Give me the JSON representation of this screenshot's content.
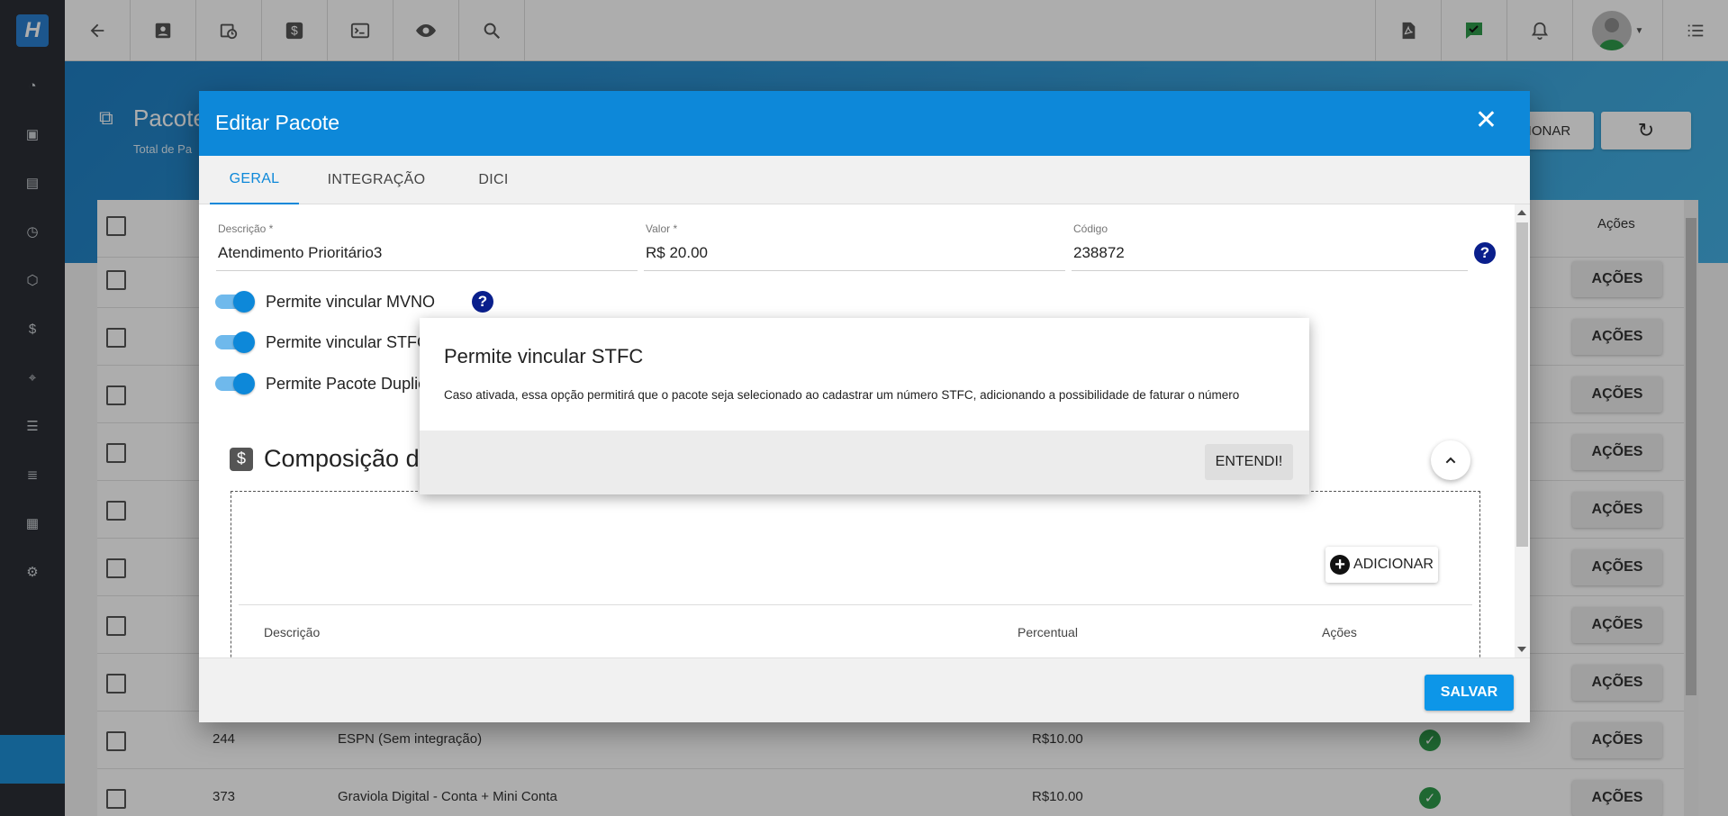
{
  "background": {
    "page_title": "Pacote",
    "page_subtitle": "Total de Pa",
    "header_button_partial": "CIONAR",
    "table_header_acoes": "Ações",
    "row_action_label": "AÇÕES",
    "rows": [
      {
        "id": "244",
        "descricao": "ESPN (Sem integração)",
        "valor": "R$10.00"
      },
      {
        "id": "373",
        "descricao": "Graviola Digital - Conta + Mini Conta",
        "valor": "R$10.00"
      }
    ]
  },
  "topbar_icons": [
    "back-arrow-icon",
    "contact-card-icon",
    "calendar-clock-icon",
    "dollar-icon",
    "terminal-icon",
    "eye-icon",
    "search-icon"
  ],
  "modal": {
    "title": "Editar Pacote",
    "close_symbol": "✕",
    "tabs": [
      {
        "label": "GERAL",
        "active": true
      },
      {
        "label": "INTEGRAÇÃO",
        "active": false
      },
      {
        "label": "DICI",
        "active": false
      }
    ],
    "fields": {
      "descricao": {
        "label": "Descrição *",
        "value": "Atendimento Prioritário3"
      },
      "valor": {
        "label": "Valor *",
        "value": "R$ 20.00"
      },
      "codigo": {
        "label": "Código",
        "value": "238872"
      }
    },
    "toggles": [
      {
        "label": "Permite vincular MVNO",
        "on": true
      },
      {
        "label": "Permite vincular STFC",
        "on": true
      },
      {
        "label": "Permite Pacote Duplica",
        "on": true
      }
    ],
    "composition_title": "Composição de",
    "add_button": "ADICIONAR",
    "table_headers": {
      "descricao": "Descrição",
      "percentual": "Percentual",
      "acoes": "Ações"
    },
    "save_button": "SALVAR"
  },
  "popover": {
    "title": "Permite vincular STFC",
    "text": "Caso ativada, essa opção permitirá que o pacote seja selecionado ao cadastrar um número STFC, adicionando a possibilidade de faturar o número",
    "button": "ENTENDI!"
  },
  "colors": {
    "primary": "#0d88d9",
    "sidebar": "#2b2f36",
    "success": "#2e9a4a",
    "help": "#0a1f8c"
  }
}
